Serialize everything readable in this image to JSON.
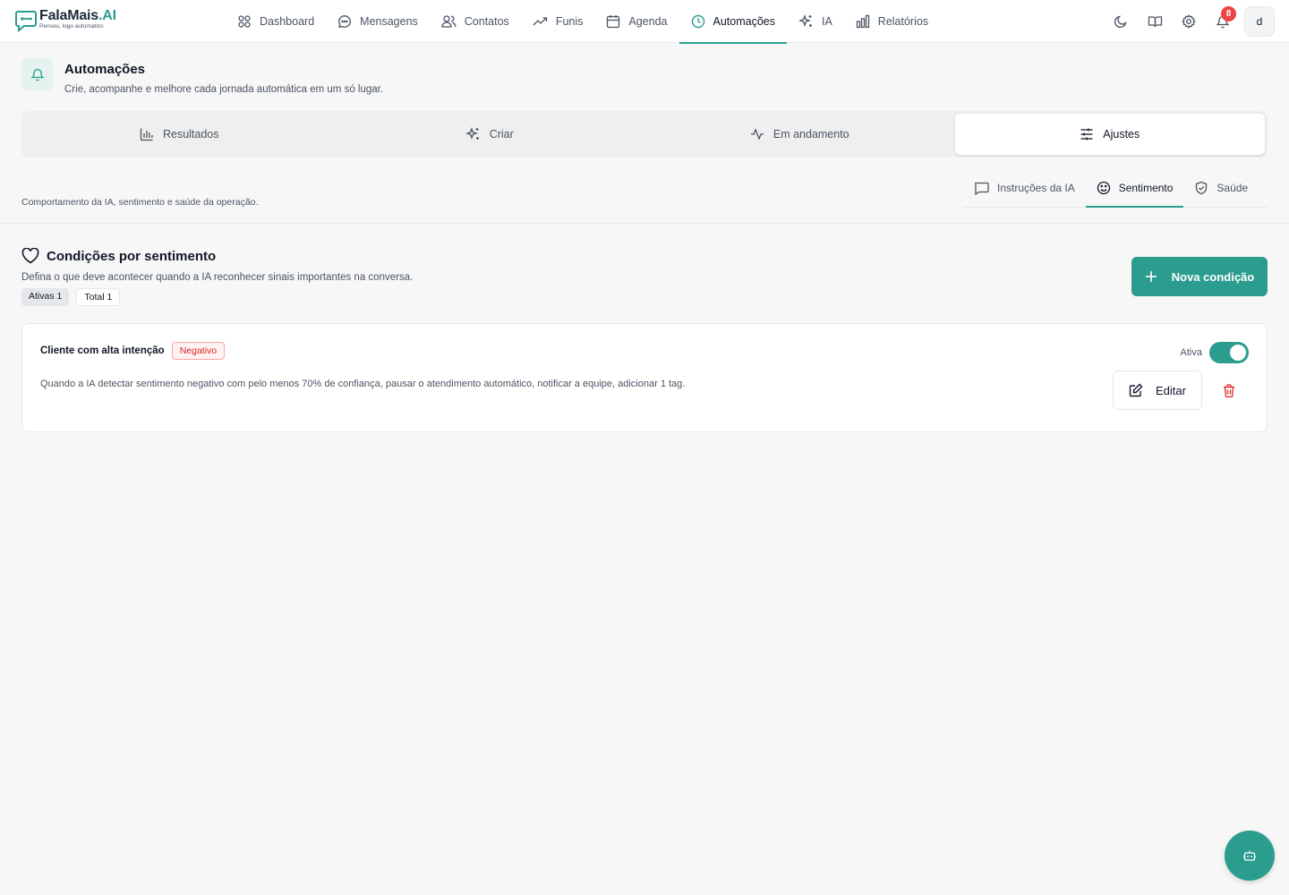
{
  "brand": {
    "name": "FalaMais",
    "name_accent": ".AI",
    "tagline": "Pensou, logo automatizo",
    "accent": "#2a9d8f"
  },
  "nav": {
    "items": [
      {
        "label": "Dashboard",
        "icon": "grid-icon"
      },
      {
        "label": "Mensagens",
        "icon": "message-icon"
      },
      {
        "label": "Contatos",
        "icon": "users-icon"
      },
      {
        "label": "Funis",
        "icon": "trending-up-icon"
      },
      {
        "label": "Agenda",
        "icon": "calendar-icon"
      },
      {
        "label": "Automações",
        "icon": "clock-icon",
        "active": true
      },
      {
        "label": "IA",
        "icon": "sparkles-icon"
      },
      {
        "label": "Relatórios",
        "icon": "bar-chart-icon"
      }
    ],
    "notifications_count": "8",
    "avatar_initial": "d"
  },
  "page": {
    "title": "Automações",
    "subtitle": "Crie, acompanhe e melhore cada jornada automática em um só lugar."
  },
  "main_tabs": [
    {
      "label": "Resultados",
      "icon": "bar-chart-icon"
    },
    {
      "label": "Criar",
      "icon": "sparkles-icon"
    },
    {
      "label": "Em andamento",
      "icon": "activity-icon"
    },
    {
      "label": "Ajustes",
      "icon": "sliders-icon",
      "active": true
    }
  ],
  "settings": {
    "description": "Comportamento da IA, sentimento e saúde da operação.",
    "sub_tabs": [
      {
        "label": "Instruções da IA",
        "icon": "message-square-icon"
      },
      {
        "label": "Sentimento",
        "icon": "smile-icon",
        "active": true
      },
      {
        "label": "Saúde",
        "icon": "shield-check-icon"
      }
    ]
  },
  "conditions": {
    "title": "Condições por sentimento",
    "subtitle": "Defina o que deve acontecer quando a IA reconhecer sinais importantes na conversa.",
    "active_chip": "Ativas 1",
    "total_chip": "Total 1",
    "new_button": "Nova condição",
    "items": [
      {
        "title": "Cliente com alta intenção",
        "badge": "Negativo",
        "description": "Quando a IA detectar sentimento negativo com pelo menos 70% de confiança, pausar o atendimento automático, notificar a equipe, adicionar 1 tag.",
        "status_label": "Ativa",
        "enabled": true,
        "edit_label": "Editar"
      }
    ]
  }
}
